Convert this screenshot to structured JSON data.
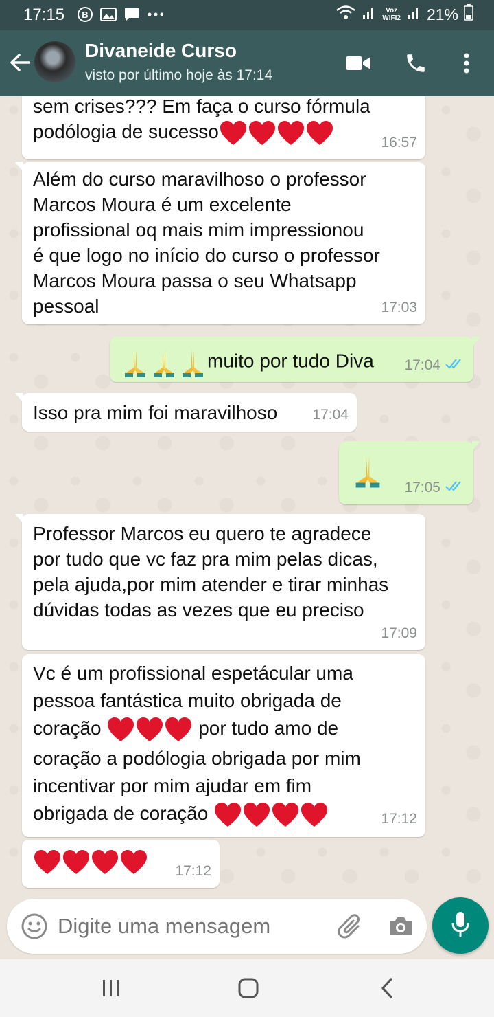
{
  "status_bar": {
    "time": "17:15",
    "carrier_label": "Voz\nWIFI2",
    "battery": "21%",
    "icons": [
      "b-icon",
      "image-icon",
      "chat-icon",
      "more-dots-icon",
      "wifi-icon",
      "signal-icon",
      "battery-icon"
    ]
  },
  "header": {
    "contact_name": "Divaneide Curso",
    "last_seen": "visto por último hoje às 17:14",
    "icons": [
      "back-arrow-icon",
      "video-call-icon",
      "phone-icon",
      "more-vert-icon"
    ]
  },
  "messages": [
    {
      "direction": "in",
      "text": "sem crises??? Em faça o curso fórmula\npodólogia de sucesso",
      "emoji": "❤️❤️❤️❤️",
      "time": "16:57"
    },
    {
      "direction": "in",
      "text": "Além do curso maravilhoso o professor\nMarcos Moura é um excelente\nprofissional oq mais mim impressionou\né que logo no início do curso o professor\nMarcos Moura passa o seu Whatsapp\npessoal",
      "time": "17:03"
    },
    {
      "direction": "out",
      "emoji": "🙏🙏🙏",
      "text": "muito por tudo Diva",
      "time": "17:04",
      "status": "read"
    },
    {
      "direction": "in",
      "text": "Isso pra mim foi maravilhoso",
      "time": "17:04"
    },
    {
      "direction": "out",
      "emoji": "🙏",
      "text": "",
      "time": "17:05",
      "status": "read"
    },
    {
      "direction": "in",
      "text": "Professor Marcos eu quero te agradece\npor tudo que vc faz pra mim pelas dicas,\npela ajuda,por mim atender e tirar minhas\ndúvidas todas as vezes que eu preciso",
      "time": "17:09"
    },
    {
      "direction": "in",
      "line1": "Vc é  um profissional espetácular uma",
      "line2": "pessoa fantástica muito obrigada de",
      "line3a": "coração",
      "hearts3": "❤️❤️❤️",
      "line3b": "por tudo amo de",
      "line4": "coração a podólogia obrigada por mim",
      "line5": "incentivar  por mim ajudar  em fim",
      "line6": "obrigada de coração",
      "hearts6": "❤️❤️❤️❤️",
      "time": "17:12"
    },
    {
      "direction": "in",
      "emoji": "❤️❤️❤️❤️",
      "text": "",
      "time": "17:12"
    }
  ],
  "composer": {
    "placeholder": "Digite uma mensagem",
    "icons": [
      "emoji-icon",
      "attach-icon",
      "camera-icon",
      "mic-icon"
    ]
  },
  "nav_bar": {
    "icons": [
      "recents-icon",
      "home-icon",
      "back-icon"
    ]
  },
  "colors": {
    "header": "#3a5c5d",
    "outgoing_bubble": "#dcf8c6",
    "incoming_bubble": "#ffffff",
    "chat_background": "#ece5dd",
    "mic_button": "#00897b",
    "read_ticks": "#4fc3f7"
  }
}
